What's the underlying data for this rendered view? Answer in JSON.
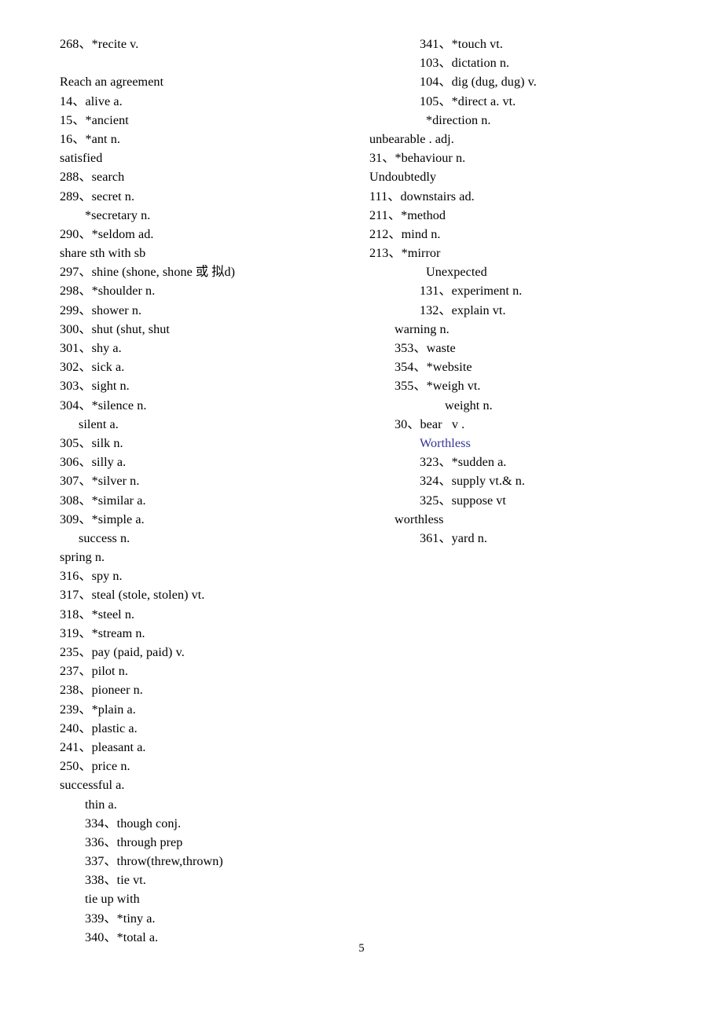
{
  "document": {
    "page_number": "5",
    "accent_color": "#333399",
    "text_color": "#000000",
    "background_color": "#ffffff"
  },
  "left_column": [
    {
      "text": "268、*recite v.",
      "indent": 0,
      "color": "default"
    },
    {
      "text": "",
      "indent": 0,
      "color": "default"
    },
    {
      "text": "Reach an agreement",
      "indent": 0,
      "color": "default"
    },
    {
      "text": "14、alive a.",
      "indent": 0,
      "color": "default"
    },
    {
      "text": "15、*ancient",
      "indent": 0,
      "color": "default"
    },
    {
      "text": "16、*ant n.",
      "indent": 0,
      "color": "default"
    },
    {
      "text": "satisfied",
      "indent": 0,
      "color": "default"
    },
    {
      "text": "288、search",
      "indent": 0,
      "color": "default"
    },
    {
      "text": "289、secret n.",
      "indent": 0,
      "color": "default"
    },
    {
      "text": "*secretary n.",
      "indent": 2,
      "color": "default"
    },
    {
      "text": "290、*seldom ad.",
      "indent": 0,
      "color": "default"
    },
    {
      "text": "share sth with sb",
      "indent": 0,
      "color": "default"
    },
    {
      "text": "297、shine (shone, shone 或 拟d)",
      "indent": 0,
      "color": "default"
    },
    {
      "text": "298、*shoulder n.",
      "indent": 0,
      "color": "default"
    },
    {
      "text": "299、shower n.",
      "indent": 0,
      "color": "default"
    },
    {
      "text": "300、shut (shut, shut",
      "indent": 0,
      "color": "default"
    },
    {
      "text": "301、shy a.",
      "indent": 0,
      "color": "default"
    },
    {
      "text": "302、sick a.",
      "indent": 0,
      "color": "default"
    },
    {
      "text": "303、sight n.",
      "indent": 0,
      "color": "default"
    },
    {
      "text": "304、*silence n.",
      "indent": 0,
      "color": "default"
    },
    {
      "text": "silent a.",
      "indent": 1,
      "color": "default"
    },
    {
      "text": "305、silk n.",
      "indent": 0,
      "color": "default"
    },
    {
      "text": "306、silly a.",
      "indent": 0,
      "color": "default"
    },
    {
      "text": "307、*silver n.",
      "indent": 0,
      "color": "default"
    },
    {
      "text": "308、*similar a.",
      "indent": 0,
      "color": "default"
    },
    {
      "text": "309、*simple a.",
      "indent": 0,
      "color": "default"
    },
    {
      "text": "success n.",
      "indent": 1,
      "color": "default"
    },
    {
      "text": "spring n.",
      "indent": 0,
      "color": "default"
    },
    {
      "text": "316、spy n.",
      "indent": 0,
      "color": "default"
    },
    {
      "text": "317、steal (stole, stolen) vt.",
      "indent": 0,
      "color": "default"
    },
    {
      "text": "318、*steel n.",
      "indent": 0,
      "color": "default"
    },
    {
      "text": "319、*stream n.",
      "indent": 0,
      "color": "default"
    },
    {
      "text": "235、pay (paid, paid) v.",
      "indent": 0,
      "color": "default"
    },
    {
      "text": "237、pilot n.",
      "indent": 0,
      "color": "default"
    },
    {
      "text": "238、pioneer n.",
      "indent": 0,
      "color": "default"
    },
    {
      "text": "239、*plain a.",
      "indent": 0,
      "color": "default"
    },
    {
      "text": "240、plastic a.",
      "indent": 0,
      "color": "default"
    },
    {
      "text": "241、pleasant a.",
      "indent": 0,
      "color": "default"
    },
    {
      "text": "250、price n.",
      "indent": 0,
      "color": "default"
    },
    {
      "text": "successful a.",
      "indent": 0,
      "color": "default"
    },
    {
      "text": "thin a.",
      "indent": 2,
      "color": "default"
    },
    {
      "text": "334、though conj.",
      "indent": 2,
      "color": "default"
    },
    {
      "text": "336、through prep",
      "indent": 2,
      "color": "default"
    },
    {
      "text": "337、throw(threw,thrown)",
      "indent": 2,
      "color": "default"
    },
    {
      "text": "338、tie vt.",
      "indent": 2,
      "color": "default"
    },
    {
      "text": "tie up with",
      "indent": 2,
      "color": "default"
    },
    {
      "text": "339、*tiny a.",
      "indent": 2,
      "color": "default"
    },
    {
      "text": "340、*total a.",
      "indent": 2,
      "color": "default"
    }
  ],
  "right_column": [
    {
      "text": "341、*touch vt.",
      "indent": 3,
      "color": "default"
    },
    {
      "text": "103、dictation n.",
      "indent": 3,
      "color": "default"
    },
    {
      "text": "104、dig (dug, dug) v.",
      "indent": 3,
      "color": "default"
    },
    {
      "text": "105、*direct a. vt.",
      "indent": 3,
      "color": "default"
    },
    {
      "text": "*direction n.",
      "indent": 4,
      "color": "default"
    },
    {
      "text": "unbearable . adj.",
      "indent": 0,
      "color": "default"
    },
    {
      "text": "31、*behaviour n.",
      "indent": 0,
      "color": "default"
    },
    {
      "text": "Undoubtedly",
      "indent": 0,
      "color": "default"
    },
    {
      "text": "111、downstairs ad.",
      "indent": 0,
      "color": "default"
    },
    {
      "text": "211、*method",
      "indent": 0,
      "color": "default"
    },
    {
      "text": "212、mind n.",
      "indent": 0,
      "color": "default"
    },
    {
      "text": "213、*mirror",
      "indent": 0,
      "color": "default"
    },
    {
      "text": "Unexpected",
      "indent": 4,
      "color": "default"
    },
    {
      "text": "131、experiment n.",
      "indent": 3,
      "color": "default"
    },
    {
      "text": "132、explain vt.",
      "indent": 3,
      "color": "default"
    },
    {
      "text": "warning n.",
      "indent": 2,
      "color": "default"
    },
    {
      "text": "353、waste",
      "indent": 2,
      "color": "default"
    },
    {
      "text": "354、*website",
      "indent": 2,
      "color": "default"
    },
    {
      "text": "355、*weigh vt.",
      "indent": 2,
      "color": "default"
    },
    {
      "text": "weight n.",
      "indent": 5,
      "color": "default"
    },
    {
      "text": "30、bear   v .",
      "indent": 2,
      "color": "default"
    },
    {
      "text": "Worthless",
      "indent": 3,
      "color": "accent"
    },
    {
      "text": "323、*sudden a.",
      "indent": 3,
      "color": "default"
    },
    {
      "text": "324、supply vt.& n.",
      "indent": 3,
      "color": "default"
    },
    {
      "text": "325、suppose vt",
      "indent": 3,
      "color": "default"
    },
    {
      "text": "worthless",
      "indent": 2,
      "color": "default"
    },
    {
      "text": "361、yard n.",
      "indent": 3,
      "color": "default"
    }
  ]
}
